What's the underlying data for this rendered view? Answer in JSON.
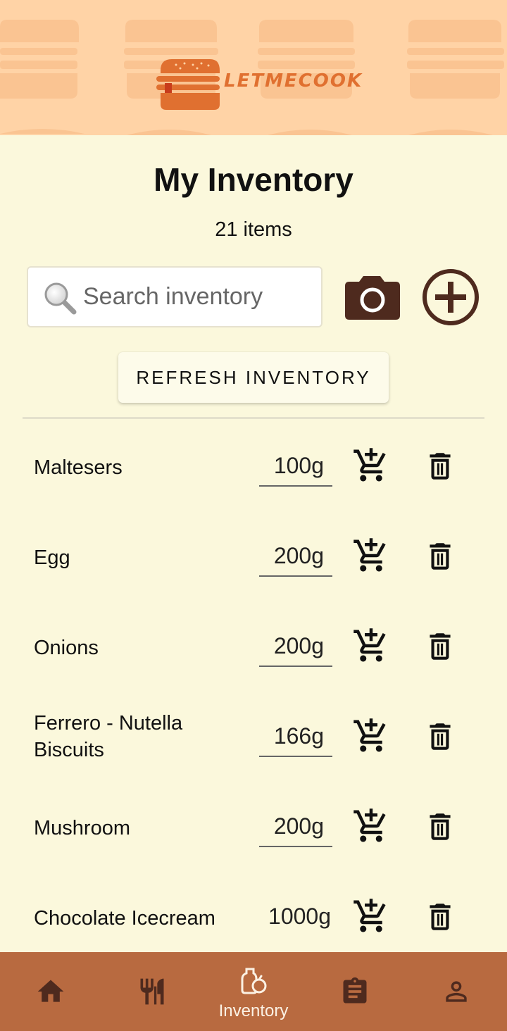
{
  "header": {
    "logo_text": "LETMECOOK"
  },
  "page": {
    "title": "My Inventory",
    "count": "21 items"
  },
  "search": {
    "placeholder": "Search inventory",
    "value": ""
  },
  "toolbar": {
    "camera_icon": "camera-icon",
    "add_icon": "add-circle-icon",
    "refresh_label": "REFRESH INVENTORY"
  },
  "inventory": [
    {
      "name": "Maltesers",
      "qty": "100g"
    },
    {
      "name": "Egg",
      "qty": "200g"
    },
    {
      "name": "Onions",
      "qty": "200g"
    },
    {
      "name": "Ferrero - Nutella Biscuits",
      "qty": "166g"
    },
    {
      "name": "Mushroom",
      "qty": "200g"
    },
    {
      "name": "Chocolate Icecream",
      "qty": "1000g"
    }
  ],
  "nav": {
    "items": [
      {
        "icon": "home-icon",
        "label": ""
      },
      {
        "icon": "restaurant-icon",
        "label": ""
      },
      {
        "icon": "inventory-icon",
        "label": "Inventory",
        "active": true
      },
      {
        "icon": "clipboard-icon",
        "label": ""
      },
      {
        "icon": "person-icon",
        "label": ""
      }
    ]
  },
  "colors": {
    "background": "#FBF8DC",
    "header": "#FFD3A6",
    "accent_brown": "#4E2A1E",
    "logo_orange": "#E07030",
    "nav_bar": "#B86A40"
  }
}
